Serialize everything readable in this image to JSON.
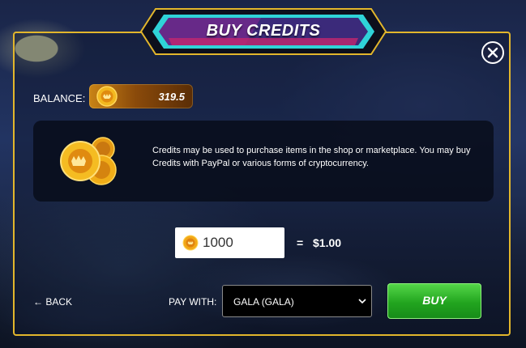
{
  "dialog": {
    "title": "BUY CREDITS",
    "close_icon": "close-icon"
  },
  "balance": {
    "label": "BALANCE:",
    "value": "319.5",
    "icon": "coin-icon"
  },
  "info": {
    "icon": "coins-stack-icon",
    "text": "Credits may be used to purchase items in the shop or marketplace. You may buy Credits with PayPal or various forms of cryptocurrency."
  },
  "purchase": {
    "amount_value": "1000",
    "amount_icon": "coin-icon",
    "equals": "=",
    "price": "$1.00"
  },
  "footer": {
    "back_label": "← BACK",
    "pay_with_label": "PAY WITH:",
    "pay_with_selected": "GALA (GALA)",
    "pay_with_icon": "chevron-down-icon",
    "buy_label": "BUY"
  },
  "colors": {
    "border_gold": "#e2b62c",
    "buy_green": "#22a51f",
    "banner_cyan": "#2fd3d8",
    "banner_magenta": "#c3276f",
    "balance_orange": "#c98416"
  }
}
